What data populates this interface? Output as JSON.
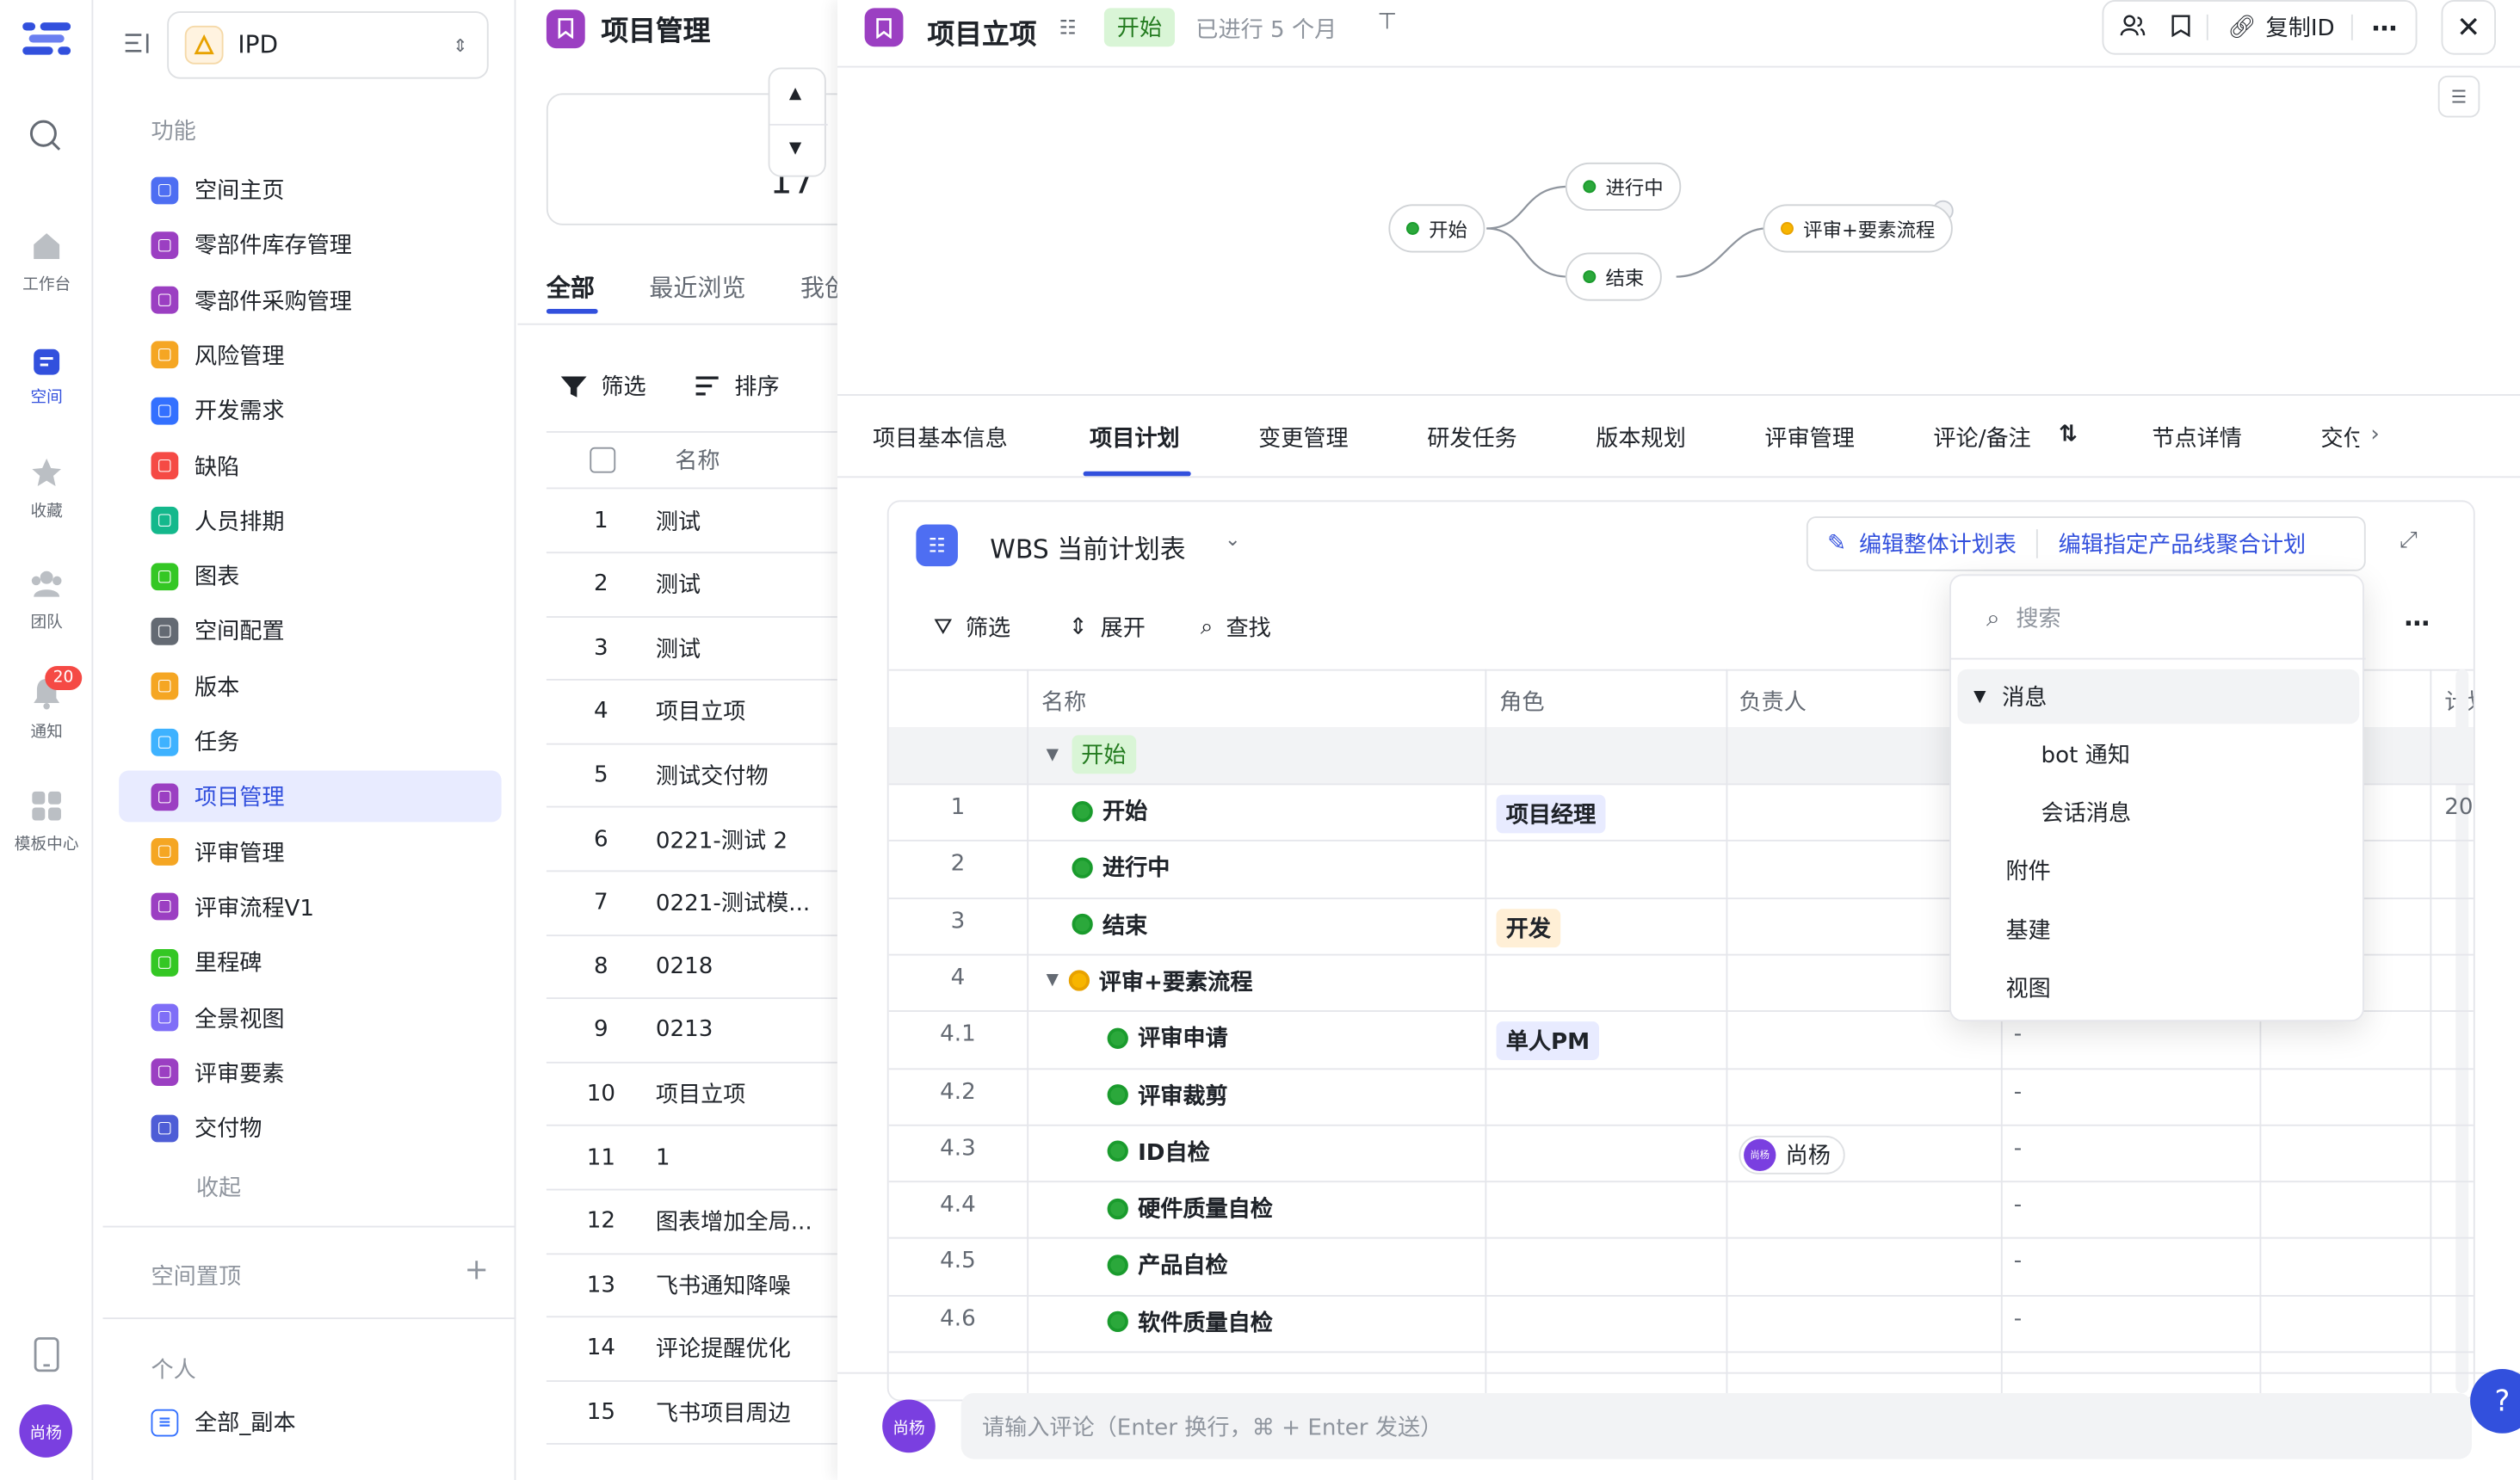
{
  "rail": {
    "items": [
      {
        "label": "工作台"
      },
      {
        "label": "空间"
      },
      {
        "label": "收藏"
      },
      {
        "label": "团队"
      },
      {
        "label": "通知",
        "badge": "20"
      },
      {
        "label": "模板中心"
      }
    ],
    "avatar": "尚杨"
  },
  "sidebar": {
    "space_name": "IPD",
    "section_features": "功能",
    "items": [
      {
        "label": "空间主页",
        "color": "#4e6ef2"
      },
      {
        "label": "零部件库存管理",
        "color": "#9b3fc2"
      },
      {
        "label": "零部件采购管理",
        "color": "#9b3fc2"
      },
      {
        "label": "风险管理",
        "color": "#f5a623"
      },
      {
        "label": "开发需求",
        "color": "#3370ff"
      },
      {
        "label": "缺陷",
        "color": "#f54a45"
      },
      {
        "label": "人员排期",
        "color": "#14b88c"
      },
      {
        "label": "图表",
        "color": "#34c724"
      },
      {
        "label": "空间配置",
        "color": "#646a73"
      },
      {
        "label": "版本",
        "color": "#f5a623"
      },
      {
        "label": "任务",
        "color": "#3eb2ff"
      },
      {
        "label": "项目管理",
        "color": "#9b3fc2"
      },
      {
        "label": "评审管理",
        "color": "#f5a623"
      },
      {
        "label": "评审流程V1",
        "color": "#9b3fc2"
      },
      {
        "label": "里程碑",
        "color": "#34c724"
      },
      {
        "label": "全景视图",
        "color": "#7f6ef7"
      },
      {
        "label": "评审要素",
        "color": "#9b3fc2"
      },
      {
        "label": "交付物",
        "color": "#4e5dd6"
      }
    ],
    "collapse": "收起",
    "pinned": "空间置顶",
    "personal": "个人",
    "personal_item": "全部_副本"
  },
  "list_pane": {
    "title": "项目管理",
    "count_fragment": "17",
    "tabs": [
      "全部",
      "最近浏览",
      "我创"
    ],
    "filter": "筛选",
    "sort": "排序",
    "header_name": "名称",
    "rows": [
      {
        "n": "1",
        "name": "测试"
      },
      {
        "n": "2",
        "name": "测试"
      },
      {
        "n": "3",
        "name": "测试"
      },
      {
        "n": "4",
        "name": "项目立项"
      },
      {
        "n": "5",
        "name": "测试交付物"
      },
      {
        "n": "6",
        "name": "0221-测试 2"
      },
      {
        "n": "7",
        "name": "0221-测试模..."
      },
      {
        "n": "8",
        "name": "0218"
      },
      {
        "n": "9",
        "name": "0213"
      },
      {
        "n": "10",
        "name": "项目立项"
      },
      {
        "n": "11",
        "name": "1"
      },
      {
        "n": "12",
        "name": "图表增加全局..."
      },
      {
        "n": "13",
        "name": "飞书通知降噪"
      },
      {
        "n": "14",
        "name": "评论提醒优化"
      },
      {
        "n": "15",
        "name": "飞书项目周边"
      }
    ]
  },
  "detail": {
    "title": "项目立项",
    "status": "开始",
    "elapsed": "已进行 5 个月",
    "copy_id": "复制ID",
    "flow": {
      "nodes": [
        "开始",
        "进行中",
        "结束",
        "评审+要素流程"
      ]
    },
    "tabs": [
      "项目基本信息",
      "项目计划",
      "变更管理",
      "研发任务",
      "版本规划",
      "评审管理",
      "评论/备注",
      "节点详情",
      "交付"
    ],
    "wbs": {
      "title": "WBS 当前计划表",
      "edit_all": "编辑整体计划表",
      "edit_line": "编辑指定产品线聚合计划",
      "toolbar": {
        "filter": "筛选",
        "expand": "展开",
        "find": "查找"
      },
      "headers": [
        "名称",
        "角色",
        "负责人",
        "计划"
      ],
      "group": "开始",
      "rows": [
        {
          "n": "1",
          "name": "开始",
          "role": "项目经理",
          "owner": "",
          "plan": "20",
          "dot": "green"
        },
        {
          "n": "2",
          "name": "进行中",
          "role": "",
          "owner": "",
          "plan": "",
          "dot": "green"
        },
        {
          "n": "3",
          "name": "结束",
          "role": "开发",
          "owner": "",
          "plan": "",
          "dot": "green"
        },
        {
          "n": "4",
          "name": "评审+要素流程",
          "role": "",
          "owner": "",
          "plan": "",
          "dot": "yellow"
        },
        {
          "n": "4.1",
          "name": "评审申请",
          "role": "单人PM",
          "owner": "",
          "plan": "-",
          "dot": "green"
        },
        {
          "n": "4.2",
          "name": "评审裁剪",
          "role": "",
          "owner": "",
          "plan": "-",
          "dot": "green"
        },
        {
          "n": "4.3",
          "name": "ID自检",
          "role": "",
          "owner": "尚杨",
          "plan": "-",
          "dot": "green"
        },
        {
          "n": "4.4",
          "name": "硬件质量自检",
          "role": "",
          "owner": "",
          "plan": "-",
          "dot": "green"
        },
        {
          "n": "4.5",
          "name": "产品自检",
          "role": "",
          "owner": "",
          "plan": "-",
          "dot": "green"
        },
        {
          "n": "4.6",
          "name": "软件质量自检",
          "role": "",
          "owner": "",
          "plan": "-",
          "dot": "green"
        }
      ]
    },
    "dropdown": {
      "search_placeholder": "搜索",
      "group": "消息",
      "sub_items": [
        "bot 通知",
        "会话消息"
      ],
      "items": [
        "附件",
        "基建",
        "视图"
      ]
    },
    "comment": {
      "avatar": "尚杨",
      "placeholder": "请输入评论（Enter 换行，⌘ + Enter 发送）"
    }
  },
  "colors": {
    "accent": "#3250dd",
    "green": "#2ba83b",
    "yellow": "#f7b500"
  }
}
